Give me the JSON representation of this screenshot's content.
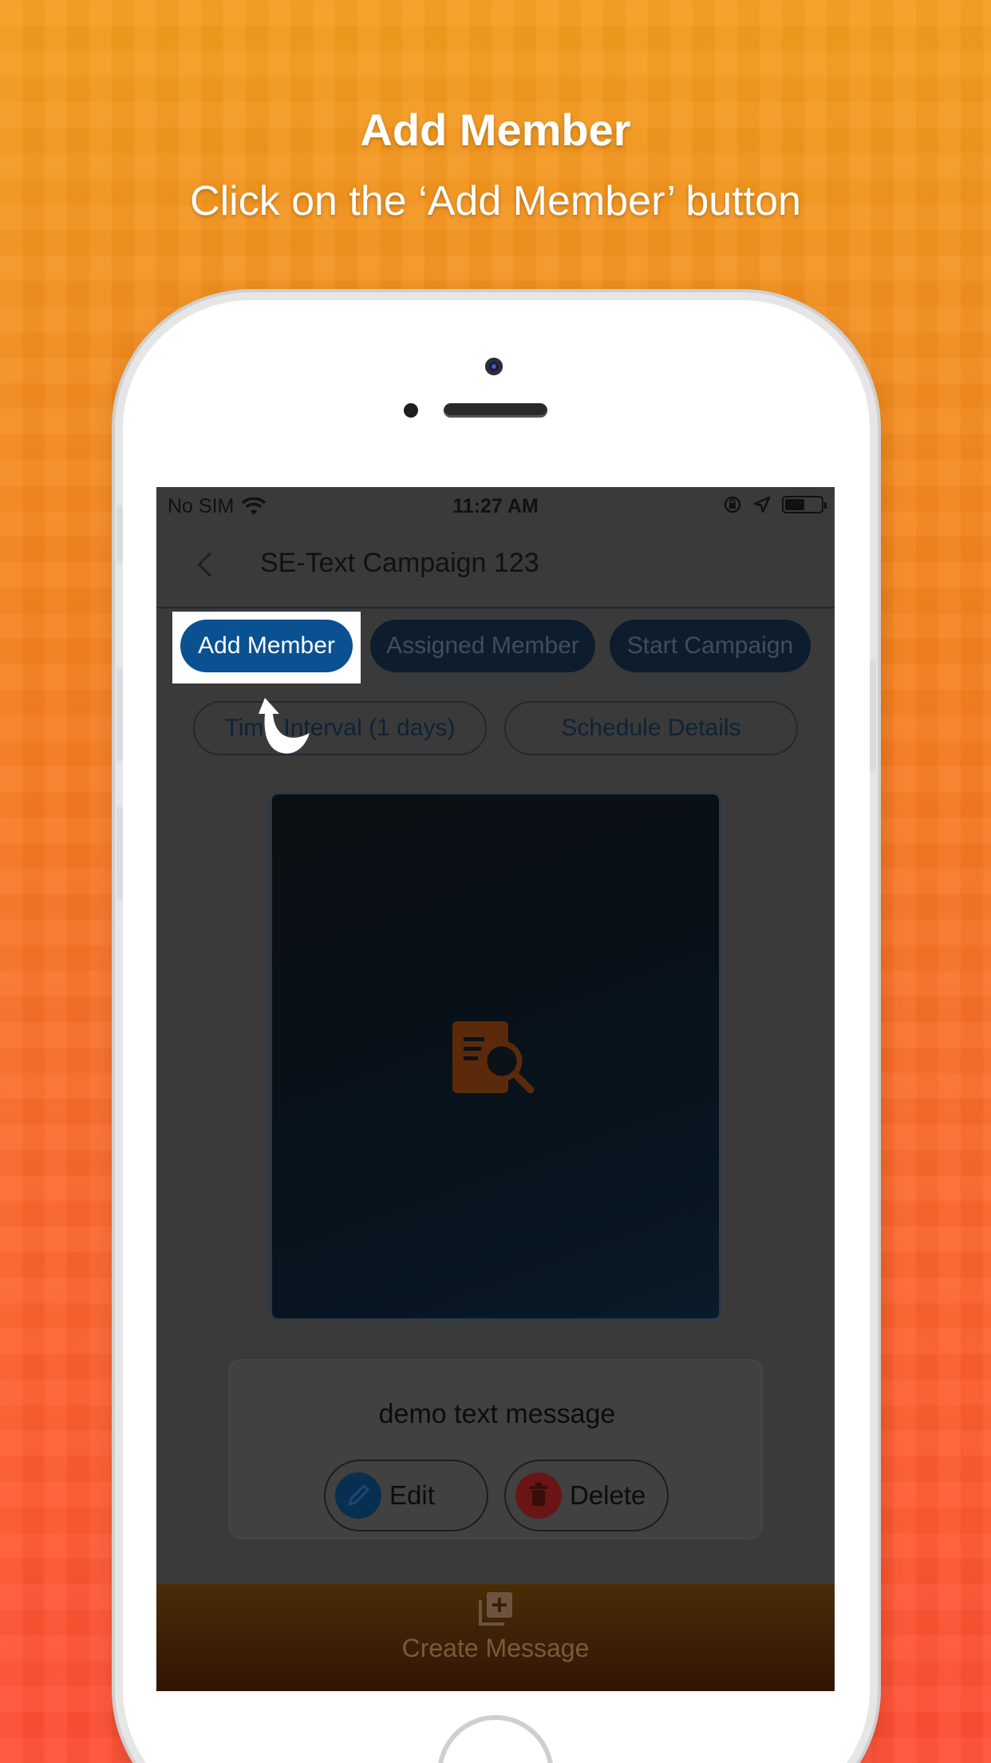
{
  "promo": {
    "title": "Add Member",
    "subtitle": "Click on the ‘Add Member’ button"
  },
  "status_bar": {
    "carrier": "No SIM",
    "time": "11:27 AM",
    "icons": [
      "wifi-icon",
      "orientation-lock-icon",
      "location-arrow-icon",
      "battery-icon"
    ],
    "battery_level": 0.5
  },
  "nav": {
    "back_icon": "chevron-left-icon",
    "title": "SE-Text Campaign 123"
  },
  "actions": {
    "add_member": "Add Member",
    "assigned_member": "Assigned Member",
    "start_campaign": "Start Campaign",
    "time_interval": "Time Interval (1 days)",
    "schedule_details": "Schedule Details"
  },
  "message": {
    "text": "demo text message",
    "edit_label": "Edit",
    "delete_label": "Delete",
    "edit_icon": "pencil-icon",
    "delete_icon": "trash-icon"
  },
  "bottom_bar": {
    "label": "Create Message",
    "icon": "add-stack-icon"
  },
  "colors": {
    "primary_blue": "#0a5192",
    "accent_orange": "#f5831f"
  }
}
